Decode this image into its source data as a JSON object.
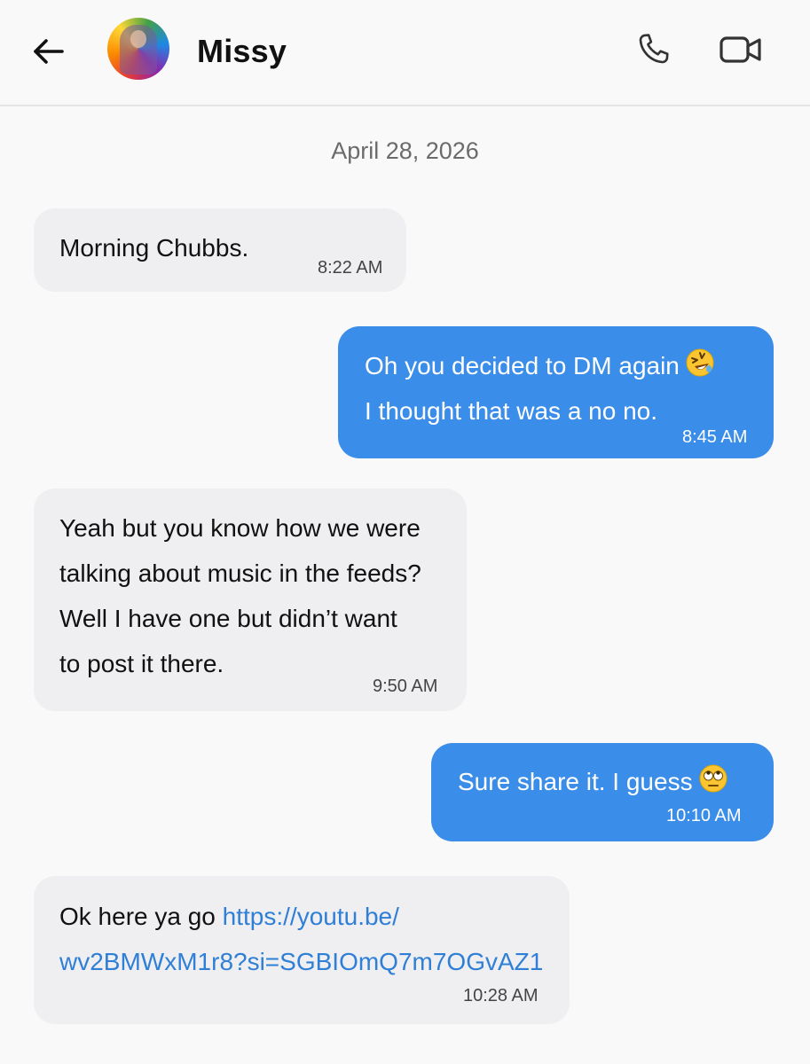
{
  "header": {
    "contact_name": "Missy"
  },
  "date_divider": "April 28, 2026",
  "messages": [
    {
      "direction": "incoming",
      "lines": [
        "Morning Chubbs."
      ],
      "time": "8:22 AM"
    },
    {
      "direction": "outgoing",
      "lines": [
        "Oh you decided to DM again",
        "I thought that was a no no."
      ],
      "emoji": "rolling-on-floor-laughing",
      "time": "8:45 AM"
    },
    {
      "direction": "incoming",
      "lines": [
        "Yeah but you know how we were",
        "talking about music in the feeds?",
        "Well I have one but didn’t want",
        "to post it there."
      ],
      "time": "9:50 AM"
    },
    {
      "direction": "outgoing",
      "lines": [
        "Sure share it. I guess"
      ],
      "emoji": "face-with-rolling-eyes",
      "time": "10:10 AM"
    },
    {
      "direction": "incoming",
      "text_prefix": "Ok here ya go ",
      "link_line1": "https://youtu.be/",
      "link_line2": "wv2BMWxM1r8?si=SGBIOmQ7m7OGvAZ1",
      "time": "10:28 AM"
    }
  ],
  "icons": {
    "back": "back-arrow-icon",
    "call": "phone-icon",
    "video": "video-camera-icon"
  },
  "colors": {
    "incoming_bubble": "#efeff1",
    "outgoing_bubble": "#3a8de8",
    "link": "#2f7fd6",
    "background": "#f9f9f9"
  }
}
